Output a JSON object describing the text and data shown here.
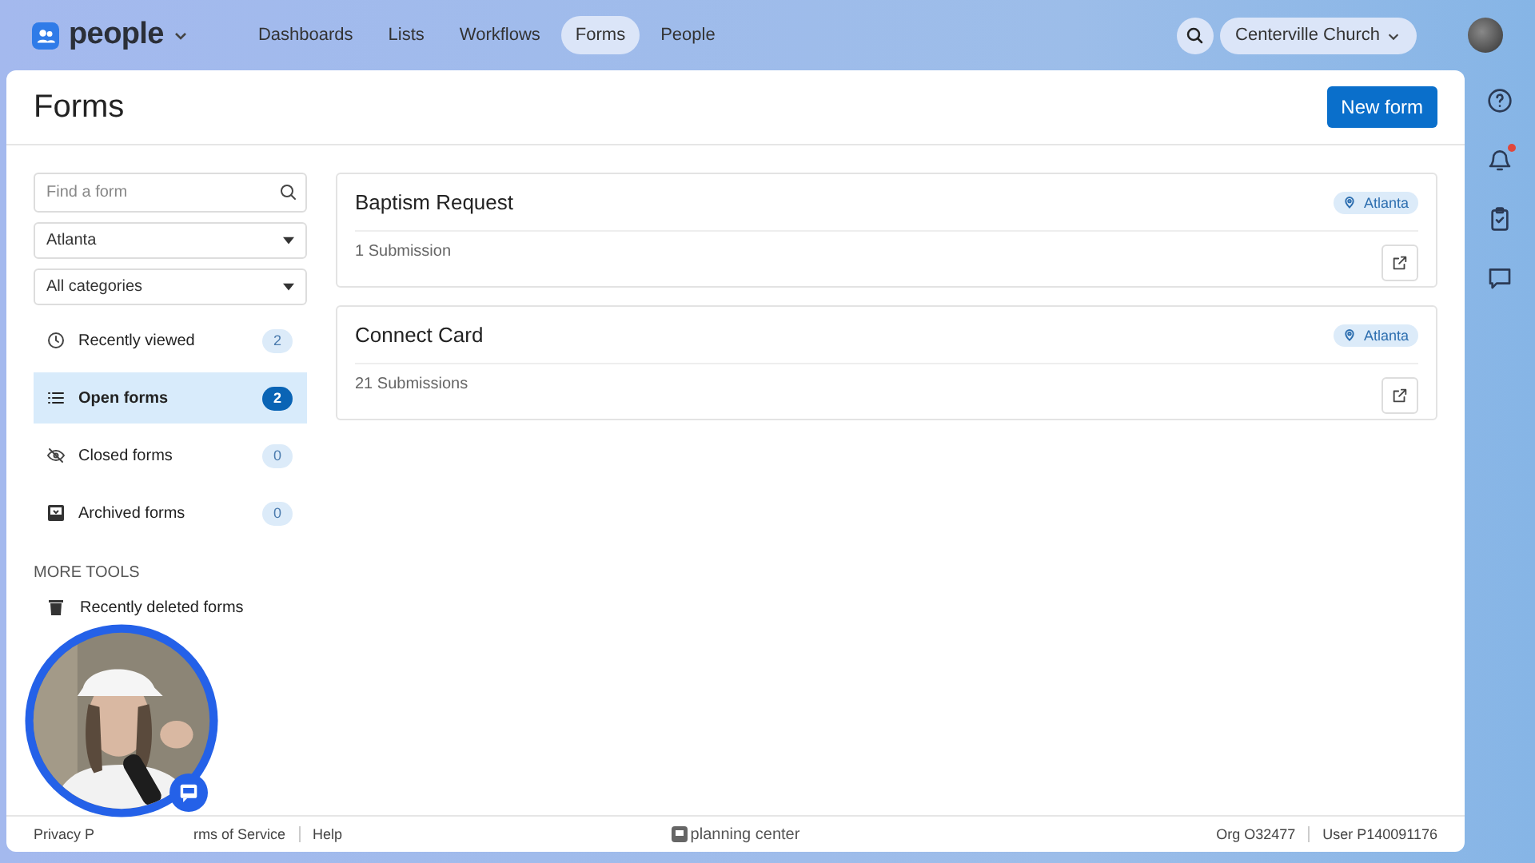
{
  "app": {
    "name": "people"
  },
  "nav": [
    {
      "label": "Dashboards",
      "selected": false
    },
    {
      "label": "Lists",
      "selected": false
    },
    {
      "label": "Workflows",
      "selected": false
    },
    {
      "label": "Forms",
      "selected": true
    },
    {
      "label": "People",
      "selected": false
    }
  ],
  "org_switcher": {
    "label": "Centerville Church"
  },
  "rail": [
    {
      "kind": "help",
      "alert": false
    },
    {
      "kind": "bell",
      "alert": true
    },
    {
      "kind": "clipboard",
      "alert": false
    },
    {
      "kind": "chat",
      "alert": false
    }
  ],
  "page": {
    "title": "Forms",
    "primary_button": "New form"
  },
  "sidebar": {
    "search": {
      "placeholder": "Find a form"
    },
    "filters": [
      {
        "value": "Atlanta"
      },
      {
        "value": "All categories"
      }
    ],
    "items": [
      {
        "kind": "clock",
        "label": "Recently viewed",
        "count": "2",
        "selected": false
      },
      {
        "kind": "list",
        "label": "Open forms",
        "count": "2",
        "selected": true
      },
      {
        "kind": "eye-off",
        "label": "Closed forms",
        "count": "0",
        "selected": false
      },
      {
        "kind": "archive",
        "label": "Archived forms",
        "count": "0",
        "selected": false
      }
    ],
    "section_title": "MORE TOOLS",
    "tools": [
      {
        "kind": "trash",
        "label": "Recently deleted forms"
      }
    ]
  },
  "forms": [
    {
      "title": "Baptism Request",
      "campus": "Atlanta",
      "submissions": "1 Submission"
    },
    {
      "title": "Connect Card",
      "campus": "Atlanta",
      "submissions": "21 Submissions"
    }
  ],
  "footer": {
    "links": [
      "Privacy P",
      "rms of Service",
      "Help"
    ],
    "brand": "planning center",
    "org": "Org O32477",
    "user": "User P140091176"
  }
}
